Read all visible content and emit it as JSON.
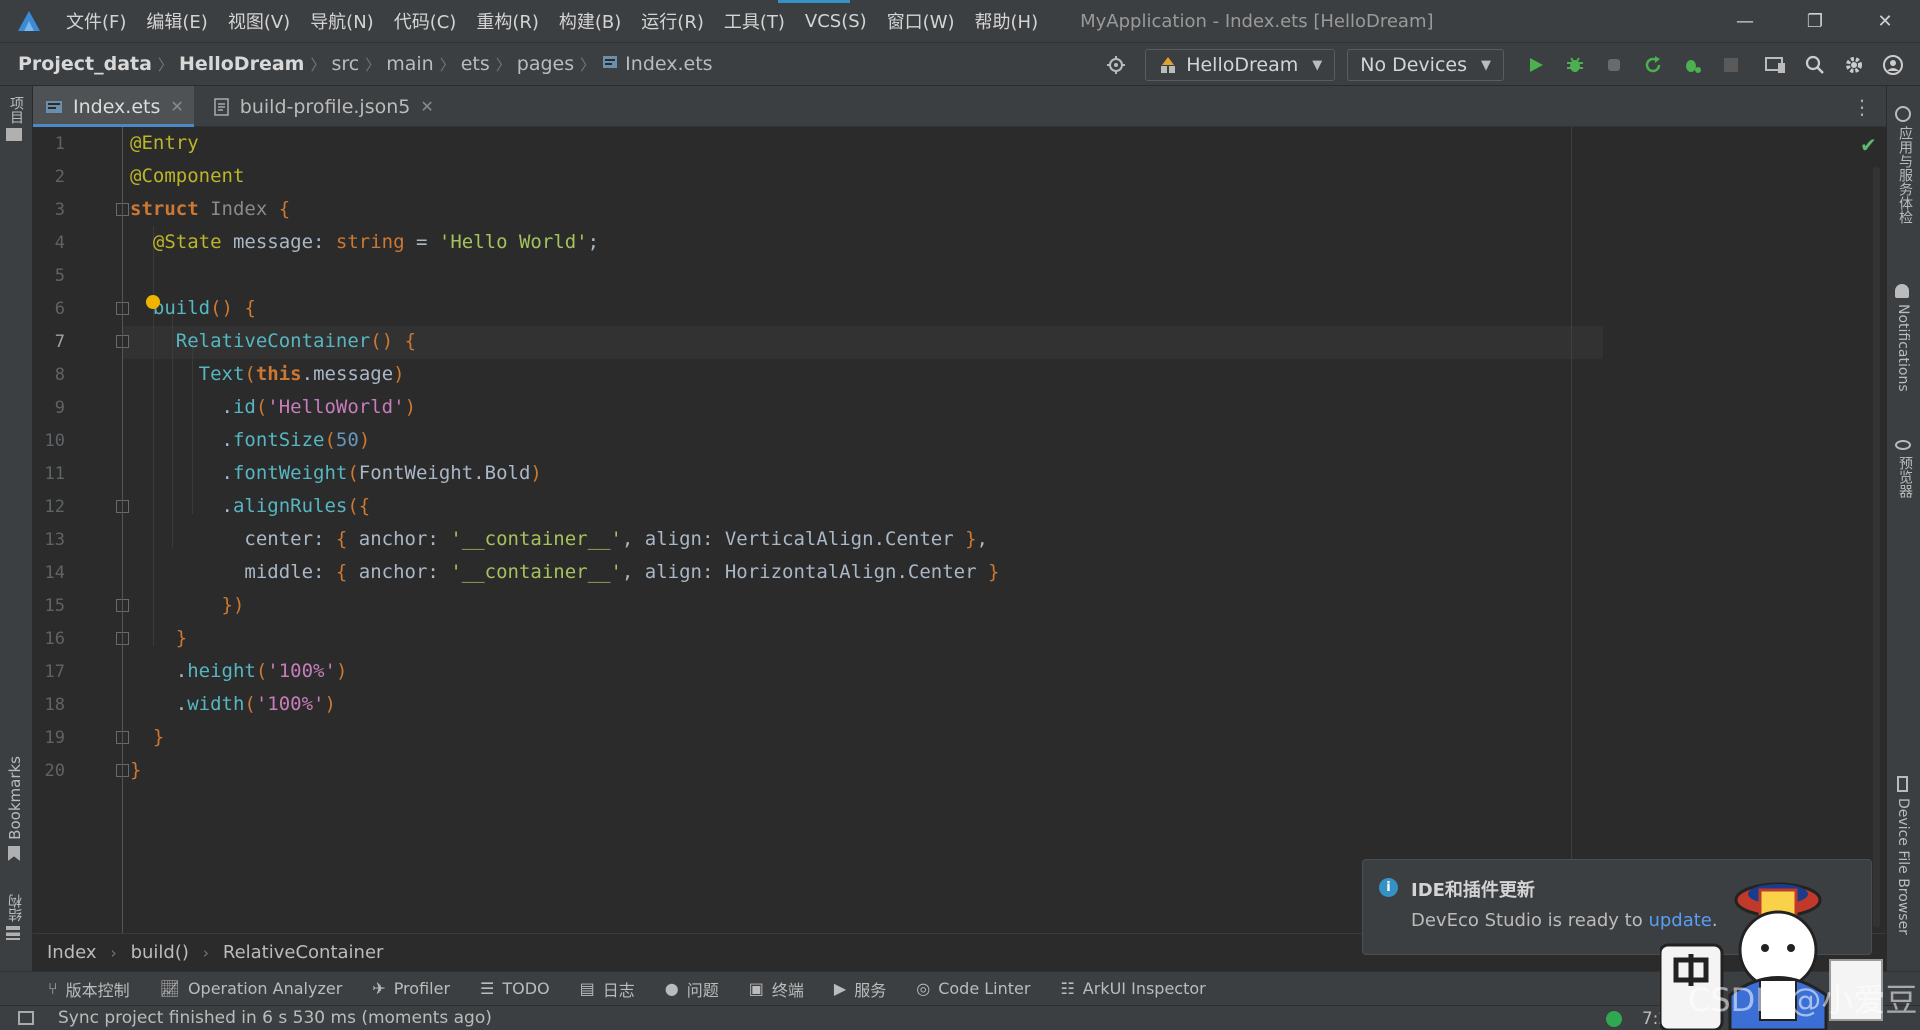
{
  "menubar": {
    "items": [
      "文件(F)",
      "编辑(E)",
      "视图(V)",
      "导航(N)",
      "代码(C)",
      "重构(R)",
      "构建(B)",
      "运行(R)",
      "工具(T)",
      "VCS(S)",
      "窗口(W)",
      "帮助(H)"
    ],
    "window_title": "MyApplication - Index.ets [HelloDream]"
  },
  "navbar": {
    "breadcrumbs": [
      "Project_data",
      "HelloDream",
      "src",
      "main",
      "ets",
      "pages",
      "Index.ets"
    ],
    "module_combo": "HelloDream",
    "device_combo": "No Devices"
  },
  "tabs": [
    {
      "label": "Index.ets",
      "active": true
    },
    {
      "label": "build-profile.json5",
      "active": false
    }
  ],
  "left_strip": {
    "project": "项目",
    "bookmarks": "Bookmarks",
    "structure": "结构"
  },
  "right_strip": {
    "app_services": "应用与服务体检",
    "notifications": "Notifications",
    "previewer": "预览器",
    "device_file_browser": "Device File Browser"
  },
  "editor": {
    "current_line": 7,
    "line_numbers": [
      "1",
      "2",
      "3",
      "4",
      "5",
      "6",
      "7",
      "8",
      "9",
      "10",
      "11",
      "12",
      "13",
      "14",
      "15",
      "16",
      "17",
      "18",
      "19",
      "20"
    ],
    "lines": [
      "@Entry",
      "@Component",
      "struct Index {",
      "  @State message: string = 'Hello World';",
      "",
      "  build() {",
      "    RelativeContainer() {",
      "      Text(this.message)",
      "        .id('HelloWorld')",
      "        .fontSize(50)",
      "        .fontWeight(FontWeight.Bold)",
      "        .alignRules({",
      "          center: { anchor: '__container__', align: VerticalAlign.Center },",
      "          middle: { anchor: '__container__', align: HorizontalAlign.Center }",
      "        })",
      "    }",
      "    .height('100%')",
      "    .width('100%')",
      "  }",
      "}"
    ]
  },
  "code_breadcrumb": [
    "Index",
    "build()",
    "RelativeContainer"
  ],
  "tool_windows": [
    "版本控制",
    "Operation Analyzer",
    "Profiler",
    "TODO",
    "日志",
    "问题",
    "终端",
    "服务",
    "Code Linter",
    "ArkUI Inspector"
  ],
  "status": {
    "message": "Sync project finished in 6 s 530 ms (moments ago)",
    "position": "7:26"
  },
  "notification": {
    "title": "IDE和插件更新",
    "body_prefix": "DevEco Studio is ready to ",
    "link": "update",
    "body_suffix": "."
  },
  "watermark": "CSDN @小爱豆",
  "colors": {
    "accent": "#4a88c7",
    "success": "#2fa84f",
    "link": "#589df6"
  }
}
